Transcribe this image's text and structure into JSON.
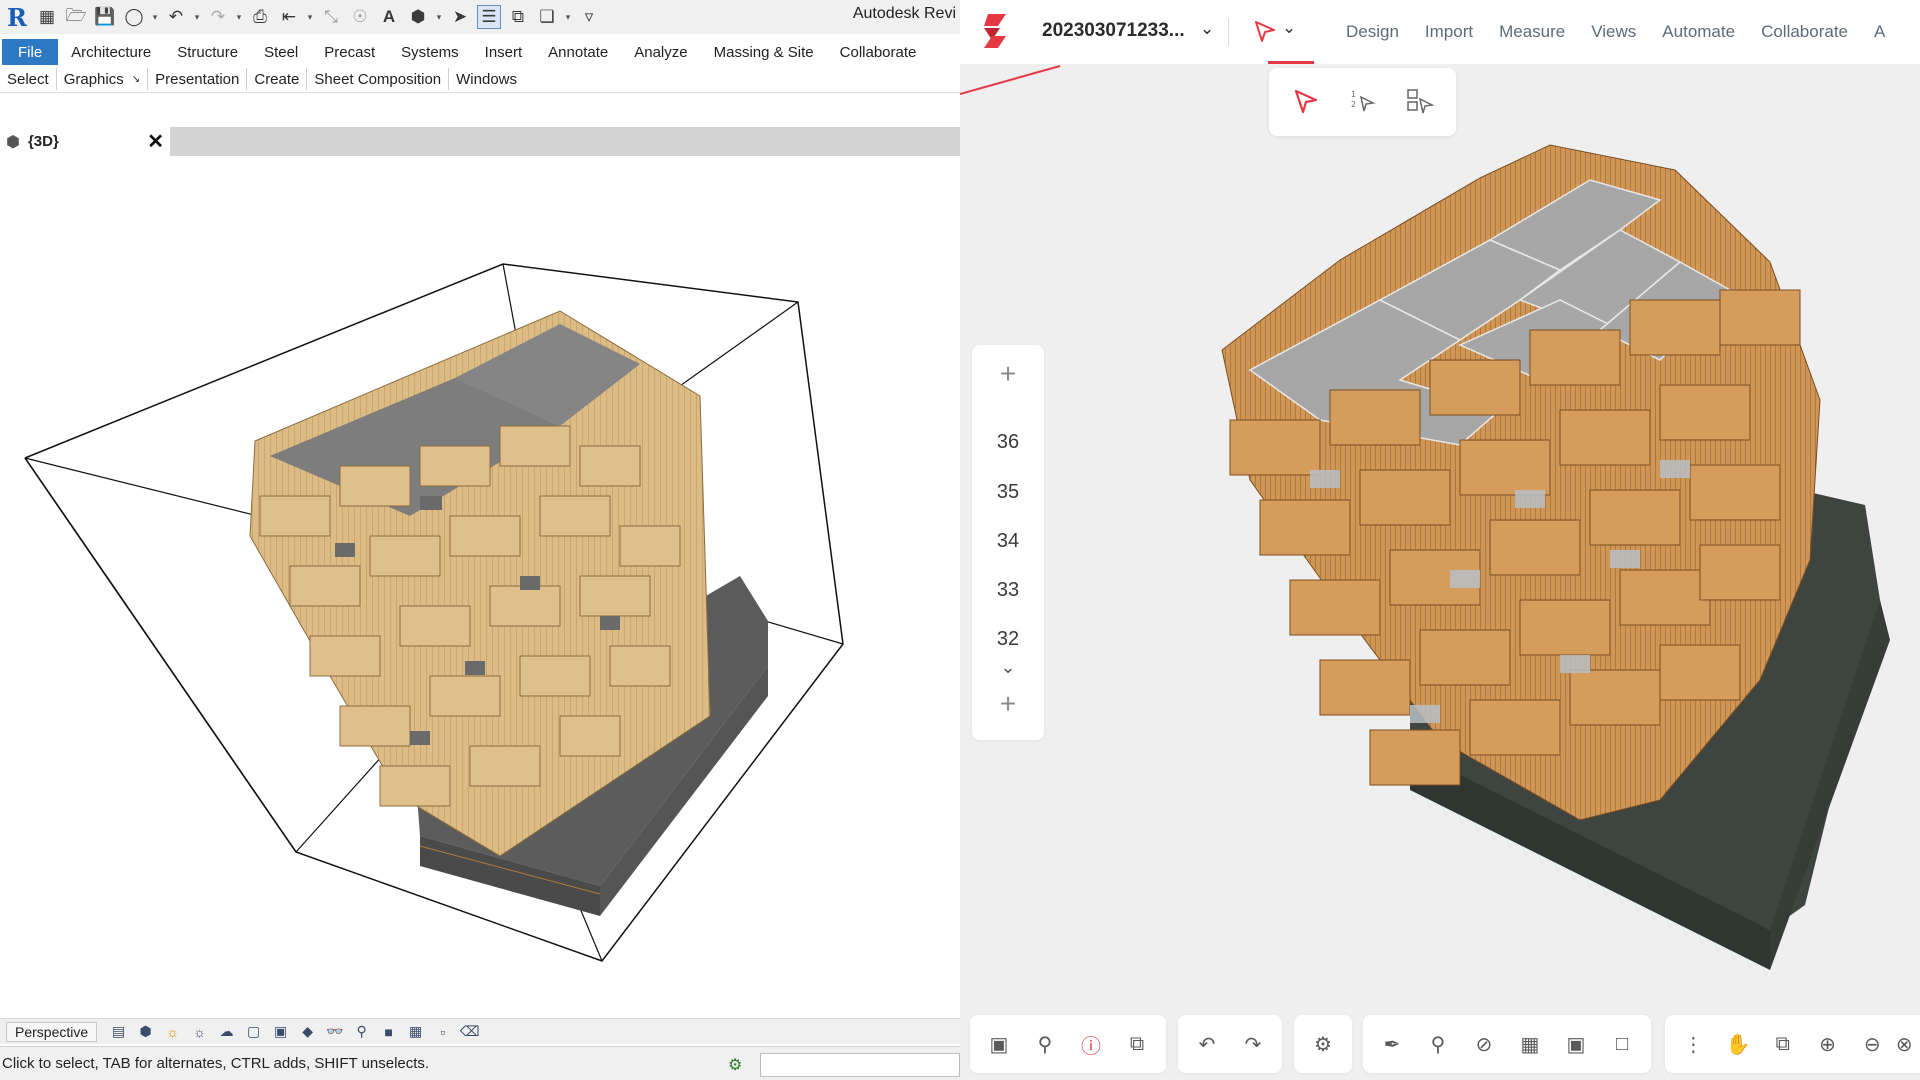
{
  "revit": {
    "logo_letter": "R",
    "title": "Autodesk Revi",
    "tabs": [
      "File",
      "Architecture",
      "Structure",
      "Steel",
      "Precast",
      "Systems",
      "Insert",
      "Annotate",
      "Analyze",
      "Massing & Site",
      "Collaborate"
    ],
    "panels": [
      "Select",
      "Graphics",
      "Presentation",
      "Create",
      "Sheet Composition",
      "Windows"
    ],
    "view_tab": {
      "label": "{3D}"
    },
    "view_mode": "Perspective",
    "status_text": "Click to select, TAB for alternates, CTRL adds, SHIFT unselects.",
    "colors": {
      "file_tab": "#2e79c4",
      "wood": "#d9b67c",
      "slab": "#8c8c8c",
      "podium": "#5a5a5a"
    }
  },
  "viewer": {
    "project_name": "202303071233...",
    "nav": [
      "Design",
      "Import",
      "Measure",
      "Views",
      "Automate",
      "Collaborate",
      "A"
    ],
    "levels": [
      "36",
      "35",
      "34",
      "33",
      "32"
    ],
    "toolbar_groups": [
      [
        "camera-icon",
        "search-plan-icon",
        "info-icon",
        "share-icon"
      ],
      [
        "undo-icon",
        "redo-icon"
      ],
      [
        "settings-icon"
      ],
      [
        "brush-icon",
        "lightbulb-icon",
        "hide-icon",
        "transform-icon",
        "lock-icon",
        "unlock-icon"
      ],
      [
        "more-icon",
        "pan-hand-icon",
        "fit-icon",
        "zoom-in-icon",
        "zoom-out-icon",
        "close-icon"
      ]
    ],
    "colors": {
      "accent": "#e63946",
      "wood": "#c98f4f",
      "podium": "#3e4540",
      "background": "#efefef"
    }
  }
}
